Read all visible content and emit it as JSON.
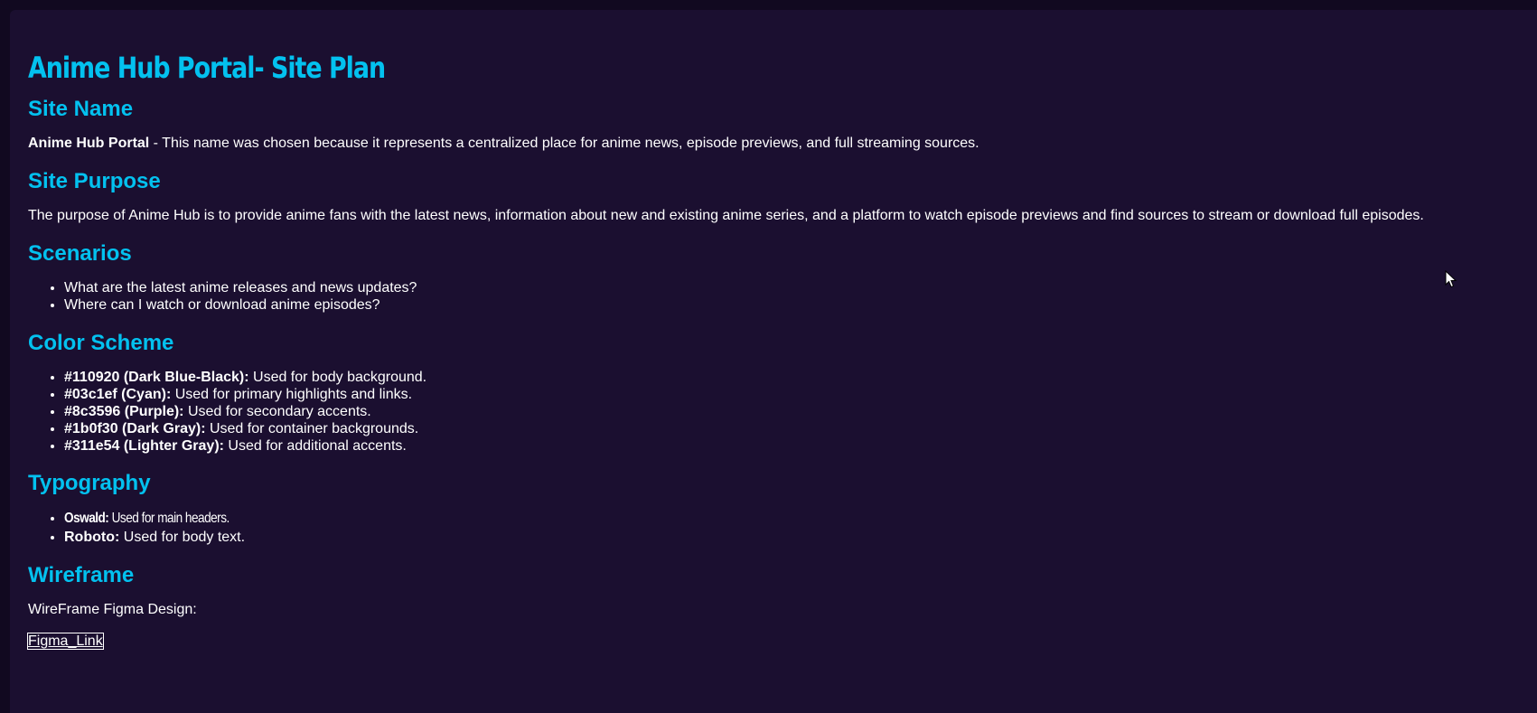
{
  "title": "Anime Hub Portal- Site Plan",
  "site_name": {
    "heading": "Site Name",
    "name_bold": "Anime Hub Portal",
    "description": " - This name was chosen because it represents a centralized place for anime news, episode previews, and full streaming sources."
  },
  "site_purpose": {
    "heading": "Site Purpose",
    "text": "The purpose of Anime Hub is to provide anime fans with the latest news, information about new and existing anime series, and a platform to watch episode previews and find sources to stream or download full episodes."
  },
  "scenarios": {
    "heading": "Scenarios",
    "items": [
      "What are the latest anime releases and news updates?",
      "Where can I watch or download anime episodes?"
    ]
  },
  "color_scheme": {
    "heading": "Color Scheme",
    "items": [
      {
        "label": "#110920 (Dark Blue-Black):",
        "text": " Used for body background.",
        "hex": "#110920"
      },
      {
        "label": "#03c1ef (Cyan):",
        "text": " Used for primary highlights and links.",
        "hex": "#03c1ef"
      },
      {
        "label": "#8c3596 (Purple):",
        "text": " Used for secondary accents.",
        "hex": "#8c3596"
      },
      {
        "label": "#1b0f30 (Dark Gray):",
        "text": " Used for container backgrounds.",
        "hex": "#1b0f30"
      },
      {
        "label": "#311e54 (Lighter Gray):",
        "text": " Used for additional accents.",
        "hex": "#311e54"
      }
    ]
  },
  "typography": {
    "heading": "Typography",
    "items": [
      {
        "label": "Oswald:",
        "text": " Used for main headers."
      },
      {
        "label": "Roboto:",
        "text": " Used for body text."
      }
    ]
  },
  "wireframe": {
    "heading": "Wireframe",
    "text": "WireFrame Figma Design:",
    "link_text": "Figma_Link"
  },
  "cursor_icon": "mouse-pointer-icon"
}
